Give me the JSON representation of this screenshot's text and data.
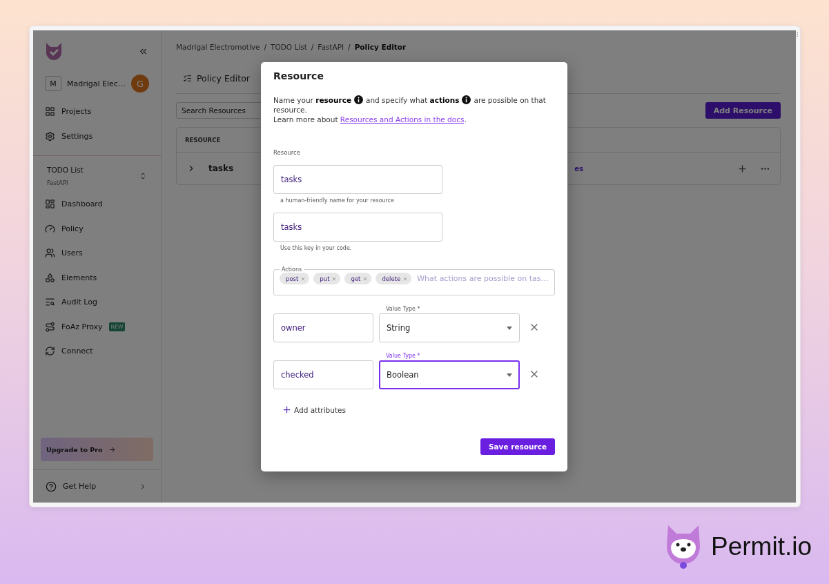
{
  "sidebar": {
    "org": {
      "initial": "M",
      "name": "Madrigal Elec…",
      "avatar": "G"
    },
    "top_items": [
      {
        "label": "Projects"
      },
      {
        "label": "Settings"
      }
    ],
    "project": {
      "name": "TODO List",
      "env": "FastAPI"
    },
    "items": [
      {
        "label": "Dashboard"
      },
      {
        "label": "Policy"
      },
      {
        "label": "Users"
      },
      {
        "label": "Elements"
      },
      {
        "label": "Audit Log"
      },
      {
        "label": "FoAz Proxy",
        "badge": "NEW"
      },
      {
        "label": "Connect"
      }
    ],
    "upgrade": "Upgrade to Pro",
    "help": "Get Help"
  },
  "main": {
    "breadcrumb": {
      "items": [
        "Madrigal Electromotive",
        "TODO List",
        "FastAPI",
        "Policy Editor"
      ],
      "separator": "/"
    },
    "tab": "Policy Editor",
    "search": {
      "placeholder": "Search Resources"
    },
    "add_button": "Add Resource",
    "table": {
      "columns": [
        "RESOURCE"
      ],
      "rows": [
        {
          "name": "tasks",
          "column_2": "es"
        }
      ]
    }
  },
  "dialog": {
    "title": "Resource",
    "intro": {
      "part_1": "Name your **resource**",
      "part_2": "and specify what **actions**",
      "part_3": "are possible on that resource.",
      "learn_more": "Learn more about",
      "link": "Resources and Actions in the docs",
      "after_link": "."
    },
    "section_label": "Resource",
    "name_field": {
      "value": "tasks",
      "helper": "a human-friendly name for your resource"
    },
    "key_field": {
      "value": "tasks",
      "helper": "Use this key in your code."
    },
    "actions": {
      "label": "Actions",
      "chips": [
        {
          "label": "post"
        },
        {
          "label": "put"
        },
        {
          "label": "get"
        },
        {
          "label": "delete"
        }
      ],
      "placeholder": "What actions are possible on tas…"
    },
    "attributes": [
      {
        "name": "owner",
        "type_label": "Value Type *",
        "type": "String",
        "focused": false
      },
      {
        "name": "checked",
        "type_label": "Value Type *",
        "type": "Boolean",
        "focused": true
      }
    ],
    "add_attributes": "Add attributes",
    "save_button": "Save resource"
  },
  "brand": {
    "text": "Permit.io"
  }
}
